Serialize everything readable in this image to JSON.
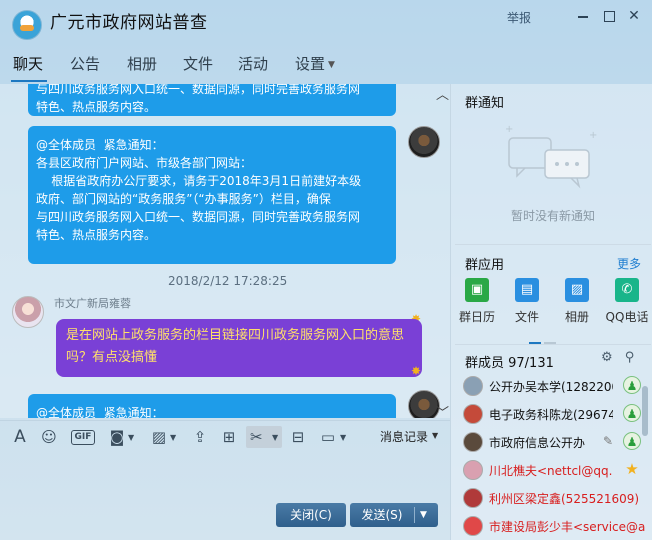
{
  "window": {
    "title": "广元市政府网站普查",
    "report": "举报"
  },
  "tabs": [
    {
      "label": "聊天",
      "active": true
    },
    {
      "label": "公告"
    },
    {
      "label": "相册"
    },
    {
      "label": "文件"
    },
    {
      "label": "活动"
    },
    {
      "label": "设置"
    }
  ],
  "chat": {
    "top_bubble_lines": [
      "与四川政务服务网入口统一、数据同源，同时完善政务服务网",
      "特色、热点服务内容。"
    ],
    "notice_bubble_lines": [
      "@全体成员  紧急通知：",
      "",
      "各县区政府门户网站、市级各部门网站：",
      "    根据省政府办公厅要求，请务于2018年3月1日前建好本级",
      "政府、部门网站的“政务服务”（“办事服务”）栏目，确保",
      "与四川政务服务网入口统一、数据同源，同时完善政务服务网",
      "特色、热点服务内容。"
    ],
    "timestamp": "2018/2/12 17:28:25",
    "sender_name": "市文广新局雍蓉",
    "question_lines": [
      "是在网站上政务服务的栏目链接四川政务服务网入口的意思",
      "吗？有点没搞懂"
    ],
    "bottom_bubble_line": "@全体成员  紧急通知："
  },
  "toolbar": {
    "gif": "GIF",
    "history": "消息记录"
  },
  "buttons": {
    "close": "关闭(C)",
    "send": "发送(S)"
  },
  "sidebar": {
    "notice_title": "群通知",
    "notice_empty": "暂时没有新通知",
    "apps_title": "群应用",
    "more": "更多",
    "apps": [
      {
        "label": "群日历",
        "color": "#2aa846",
        "icon": "calendar-icon"
      },
      {
        "label": "文件",
        "color": "#2a8fe0",
        "icon": "folder-icon"
      },
      {
        "label": "相册",
        "color": "#2a8fe0",
        "icon": "photo-icon"
      },
      {
        "label": "QQ电话",
        "color": "#19b58a",
        "icon": "phone-icon"
      }
    ],
    "members_title": "群成员 97/131",
    "members": [
      {
        "name": "公开办吴本学(1282200",
        "red": false,
        "badge": "admin"
      },
      {
        "name": "电子政务科陈龙(29674",
        "red": false,
        "badge": "admin"
      },
      {
        "name": "市政府信息公开办",
        "red": false,
        "badge": "admin",
        "edit": true
      },
      {
        "name": "川北樵夫<nettcl@qq.co",
        "red": true,
        "badge": "star"
      },
      {
        "name": "利州区梁定鑫(525521609)",
        "red": true,
        "badge": ""
      },
      {
        "name": "市建设局彭少丰<service@a",
        "red": true,
        "badge": ""
      }
    ]
  }
}
